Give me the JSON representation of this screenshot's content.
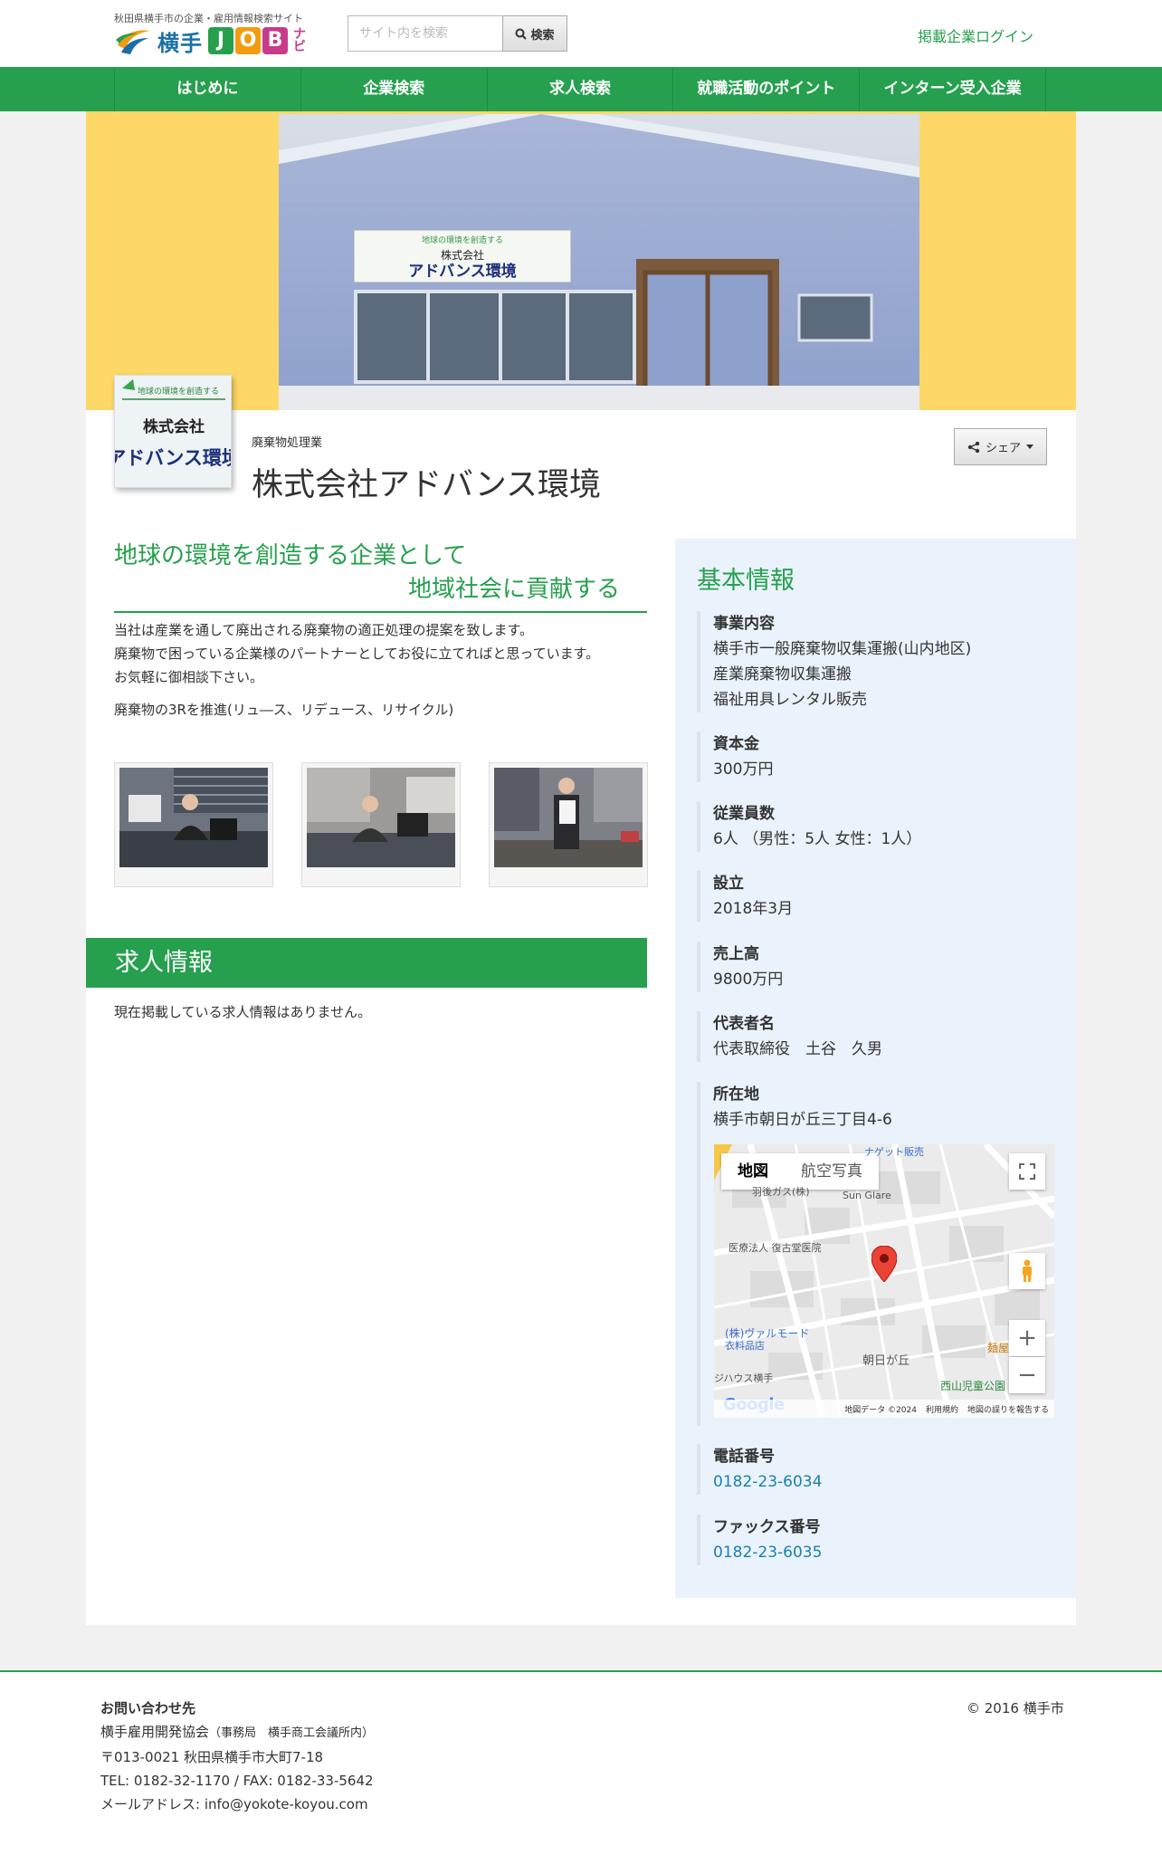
{
  "header": {
    "tagline": "秋田県横手市の企業・雇用情報検索サイト",
    "logo_text": "横手",
    "logo_job": [
      "J",
      "O",
      "B"
    ],
    "logo_navi": "ナビ",
    "search_placeholder": "サイト内を検索",
    "search_button": "検索",
    "login_link": "掲載企業ログイン"
  },
  "nav": {
    "items": [
      "はじめに",
      "企業検索",
      "求人検索",
      "就職活動のポイント",
      "インターン受入企業"
    ]
  },
  "company": {
    "industry": "廃棄物処理業",
    "name": "株式会社アドバンス環境",
    "logo_tagline": "地球の環境を創造する",
    "logo_line1": "株式会社",
    "logo_line2": "アドバンス環境",
    "sign_tagline": "地球の環境を創造する",
    "sign_line1": "株式会社",
    "sign_line2": "アドバンス環境",
    "share_button": "シェア"
  },
  "catch": {
    "line1": "地球の環境を創造する企業として",
    "line2": "地域社会に貢献する"
  },
  "description": {
    "lines": [
      "当社は産業を通して廃出される廃棄物の適正処理の提案を致します。",
      "廃棄物で困っている企業様のパートナーとしてお役に立てればと思っています。",
      "お気軽に御相談下さい。"
    ],
    "para2": "廃棄物の3Rを推進(リュ―ス、リデュース、リサイクル)"
  },
  "jobs": {
    "heading": "求人情報",
    "empty_message": "現在掲載している求人情報はありません。"
  },
  "info": {
    "title": "基本情報",
    "business_label": "事業内容",
    "business_values": [
      "横手市一般廃棄物収集運搬(山内地区)",
      "産業廃棄物収集運搬",
      "福祉用具レンタル販売"
    ],
    "capital_label": "資本金",
    "capital_value": "300万円",
    "employees_label": "従業員数",
    "employees_value": "6人 （男性：5人 女性：1人）",
    "founded_label": "設立",
    "founded_value": "2018年3月",
    "sales_label": "売上高",
    "sales_value": "9800万円",
    "rep_label": "代表者名",
    "rep_value": "代表取締役　土谷　久男",
    "address_label": "所在地",
    "address_value": "横手市朝日が丘三丁目4-6",
    "phone_label": "電話番号",
    "phone_value": "0182-23-6034",
    "fax_label": "ファックス番号",
    "fax_value": "0182-23-6035"
  },
  "map": {
    "tab_map": "地図",
    "tab_satellite": "航空写真",
    "labels": {
      "nugget": "ナゲット販売",
      "hane": "羽後ガス(株)",
      "sunglare": "Sun Glare",
      "clinic": "医療法人 復古堂医院",
      "varmode1": "(株)ヴァルモード",
      "varmode2": "衣料品店",
      "asahigaoka": "朝日が丘",
      "nishiyama": "西山児童公園",
      "house": "ジハウス横手",
      "ramen": "麺屋"
    },
    "google": "Google",
    "footer_data": "地図データ ©2024",
    "footer_terms": "利用規約",
    "footer_report": "地図の誤りを報告する"
  },
  "footer": {
    "contact_title": "お問い合わせ先",
    "org": "横手雇用開発協会",
    "org_note": "（事務局　横手商工会議所内）",
    "address": "〒013-0021 秋田県横手市大町7-18",
    "tel_fax": "TEL: 0182-32-1170 / FAX: 0182-33-5642",
    "email": "メールアドレス: info@yokote-koyou.com",
    "copyright": "© 2016 横手市"
  },
  "colors": {
    "brand_green": "#26a04e",
    "hero_yellow": "#fdd868",
    "info_bg": "#eaf3fb",
    "link_blue": "#1a7fb0"
  }
}
